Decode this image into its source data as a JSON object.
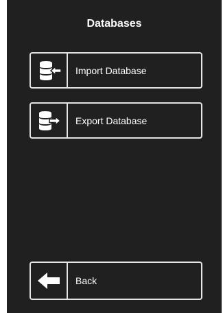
{
  "dialog": {
    "title": "Databases"
  },
  "buttons": {
    "import": {
      "label": "Import Database",
      "icon": "database-import-icon"
    },
    "export": {
      "label": "Export Database",
      "icon": "database-export-icon"
    },
    "back": {
      "label": "Back",
      "icon": "arrow-left-icon"
    }
  },
  "colors": {
    "background": "#202020",
    "border": "#e4e4e4",
    "text": "#ffffff"
  }
}
